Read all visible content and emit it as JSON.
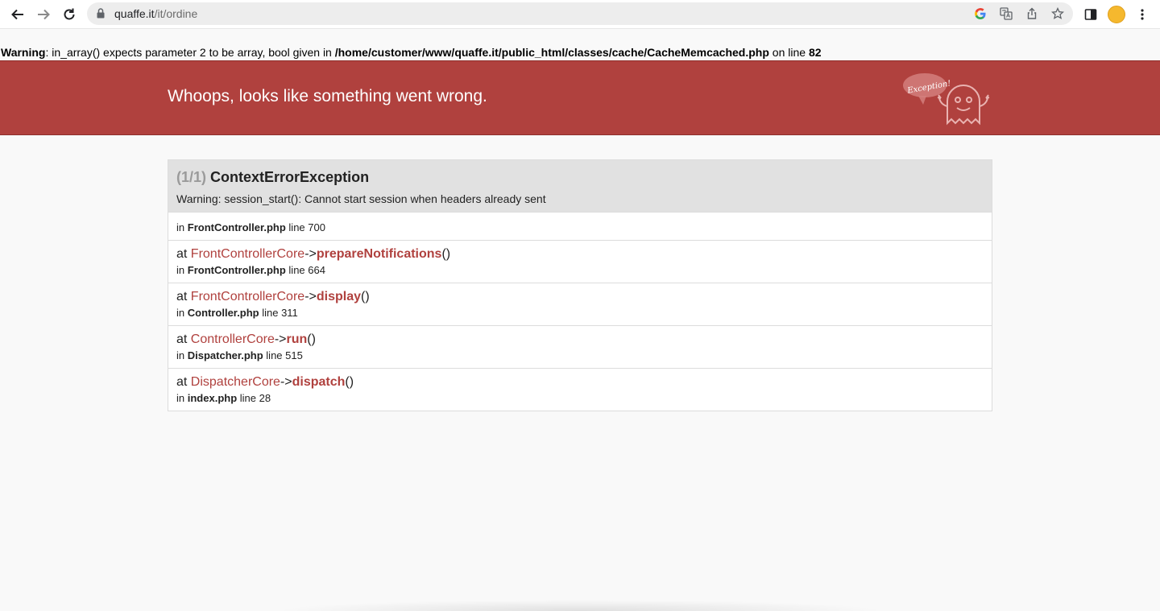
{
  "browser": {
    "url_host": "quaffe.it",
    "url_path": "/it/ordine"
  },
  "php_warning": {
    "label": "Warning",
    "text": ": in_array() expects parameter 2 to be array, bool given in ",
    "file": "/home/customer/www/quaffe.it/public_html/classes/cache/CacheMemcached.php",
    "on_line_text": " on line ",
    "line": "82"
  },
  "error_page": {
    "title": "Whoops, looks like something went wrong.",
    "ghost_bubble_text": "Exception!",
    "header_color": "#b0413e"
  },
  "exception": {
    "count": "(1/1)",
    "name": "ContextErrorException",
    "message": "Warning: session_start(): Cannot start session when headers already sent",
    "origin": {
      "in": "in",
      "file": "FrontController.php",
      "line_text": "line 700"
    },
    "trace": [
      {
        "at": "at",
        "class": "FrontControllerCore",
        "arrow": "->",
        "method": "prepareNotifications",
        "parens": "()",
        "in": "in",
        "file": "FrontController.php",
        "line_text": "line 664"
      },
      {
        "at": "at",
        "class": "FrontControllerCore",
        "arrow": "->",
        "method": "display",
        "parens": "()",
        "in": "in",
        "file": "Controller.php",
        "line_text": "line 311"
      },
      {
        "at": "at",
        "class": "ControllerCore",
        "arrow": "->",
        "method": "run",
        "parens": "()",
        "in": "in",
        "file": "Dispatcher.php",
        "line_text": "line 515"
      },
      {
        "at": "at",
        "class": "DispatcherCore",
        "arrow": "->",
        "method": "dispatch",
        "parens": "()",
        "in": "in",
        "file": "index.php",
        "line_text": "line 28"
      }
    ]
  },
  "icons": [
    "back-icon",
    "forward-icon",
    "reload-icon",
    "lock-icon",
    "google-icon",
    "translate-icon",
    "share-icon",
    "star-icon",
    "sidepanel-icon",
    "avatar",
    "menu-icon",
    "ghost-logo"
  ]
}
